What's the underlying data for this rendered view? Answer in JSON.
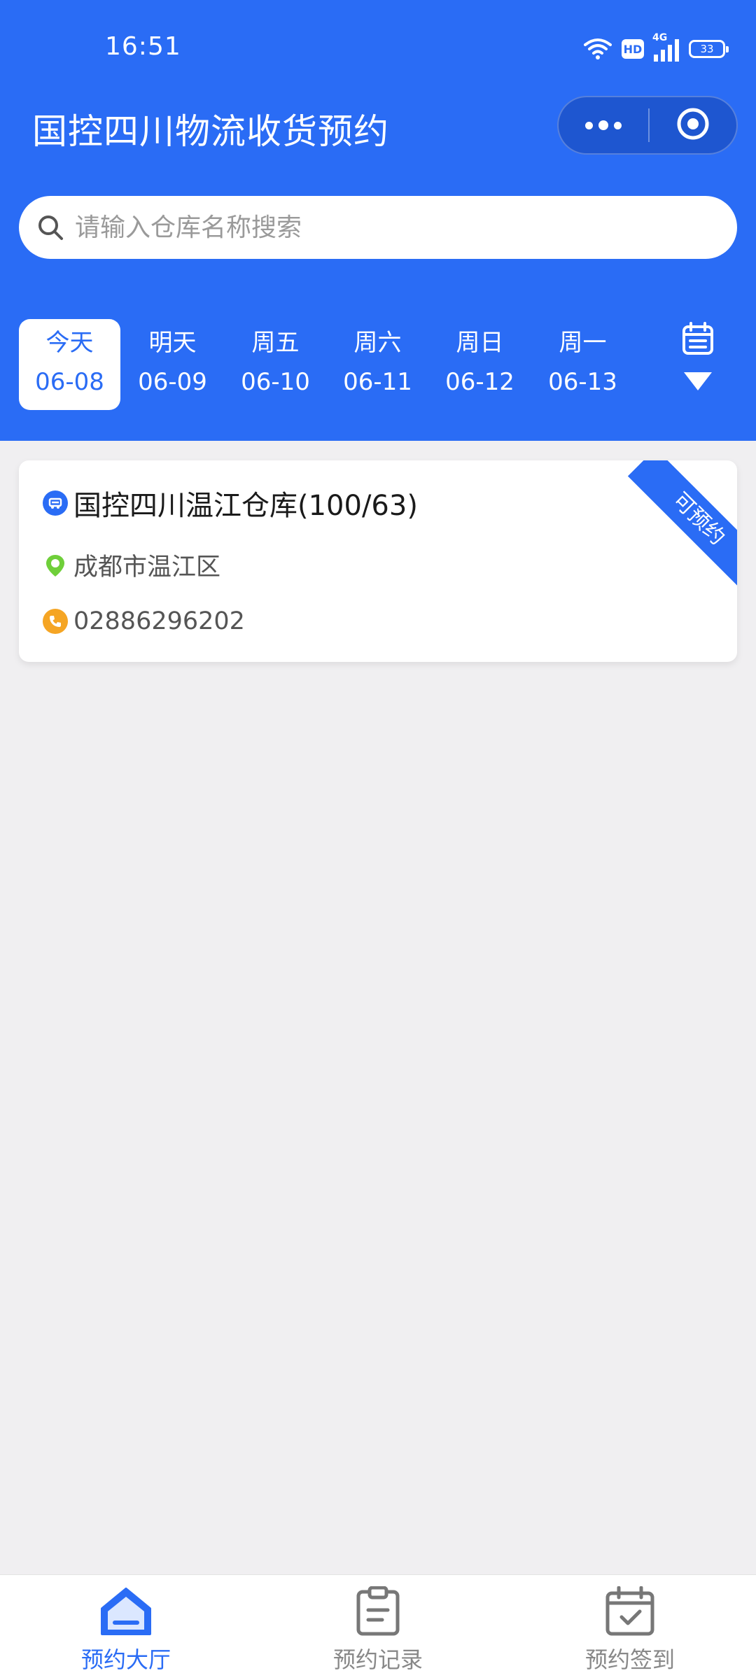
{
  "status_bar": {
    "time": "16:51",
    "network": "4G",
    "hd": "HD",
    "battery": "33"
  },
  "header": {
    "title": "国控四川物流收货预约"
  },
  "search": {
    "placeholder": "请输入仓库名称搜索"
  },
  "date_tabs": [
    {
      "day": "今天",
      "date": "06-08",
      "active": true
    },
    {
      "day": "明天",
      "date": "06-09",
      "active": false
    },
    {
      "day": "周五",
      "date": "06-10",
      "active": false
    },
    {
      "day": "周六",
      "date": "06-11",
      "active": false
    },
    {
      "day": "周日",
      "date": "06-12",
      "active": false
    },
    {
      "day": "周一",
      "date": "06-13",
      "active": false
    }
  ],
  "warehouses": [
    {
      "name": "国控四川温江仓库(100/63)",
      "district": "成都市温江区",
      "phone": "02886296202",
      "status": "可预约"
    }
  ],
  "tab_bar": {
    "items": [
      {
        "label": "预约大厅",
        "icon": "home-icon",
        "active": true
      },
      {
        "label": "预约记录",
        "icon": "clipboard-icon",
        "active": false
      },
      {
        "label": "预约签到",
        "icon": "calendar-check-icon",
        "active": false
      }
    ]
  },
  "colors": {
    "primary": "#2a6cf5",
    "background": "#f0eff1",
    "location_green": "#6fcf3a",
    "phone_orange": "#f5a524"
  }
}
